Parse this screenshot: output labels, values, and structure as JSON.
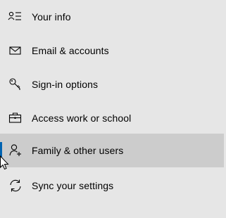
{
  "nav": {
    "items": [
      {
        "label": "Your info",
        "icon": "your-info-icon",
        "selected": false
      },
      {
        "label": "Email & accounts",
        "icon": "email-icon",
        "selected": false
      },
      {
        "label": "Sign-in options",
        "icon": "key-icon",
        "selected": false
      },
      {
        "label": "Access work or school",
        "icon": "briefcase-icon",
        "selected": false
      },
      {
        "label": "Family & other users",
        "icon": "person-add-icon",
        "selected": true
      },
      {
        "label": "Sync your settings",
        "icon": "sync-icon",
        "selected": false
      }
    ]
  },
  "colors": {
    "background": "#e6e6e6",
    "selected_background": "#cccccc",
    "accent": "#0063b1"
  }
}
